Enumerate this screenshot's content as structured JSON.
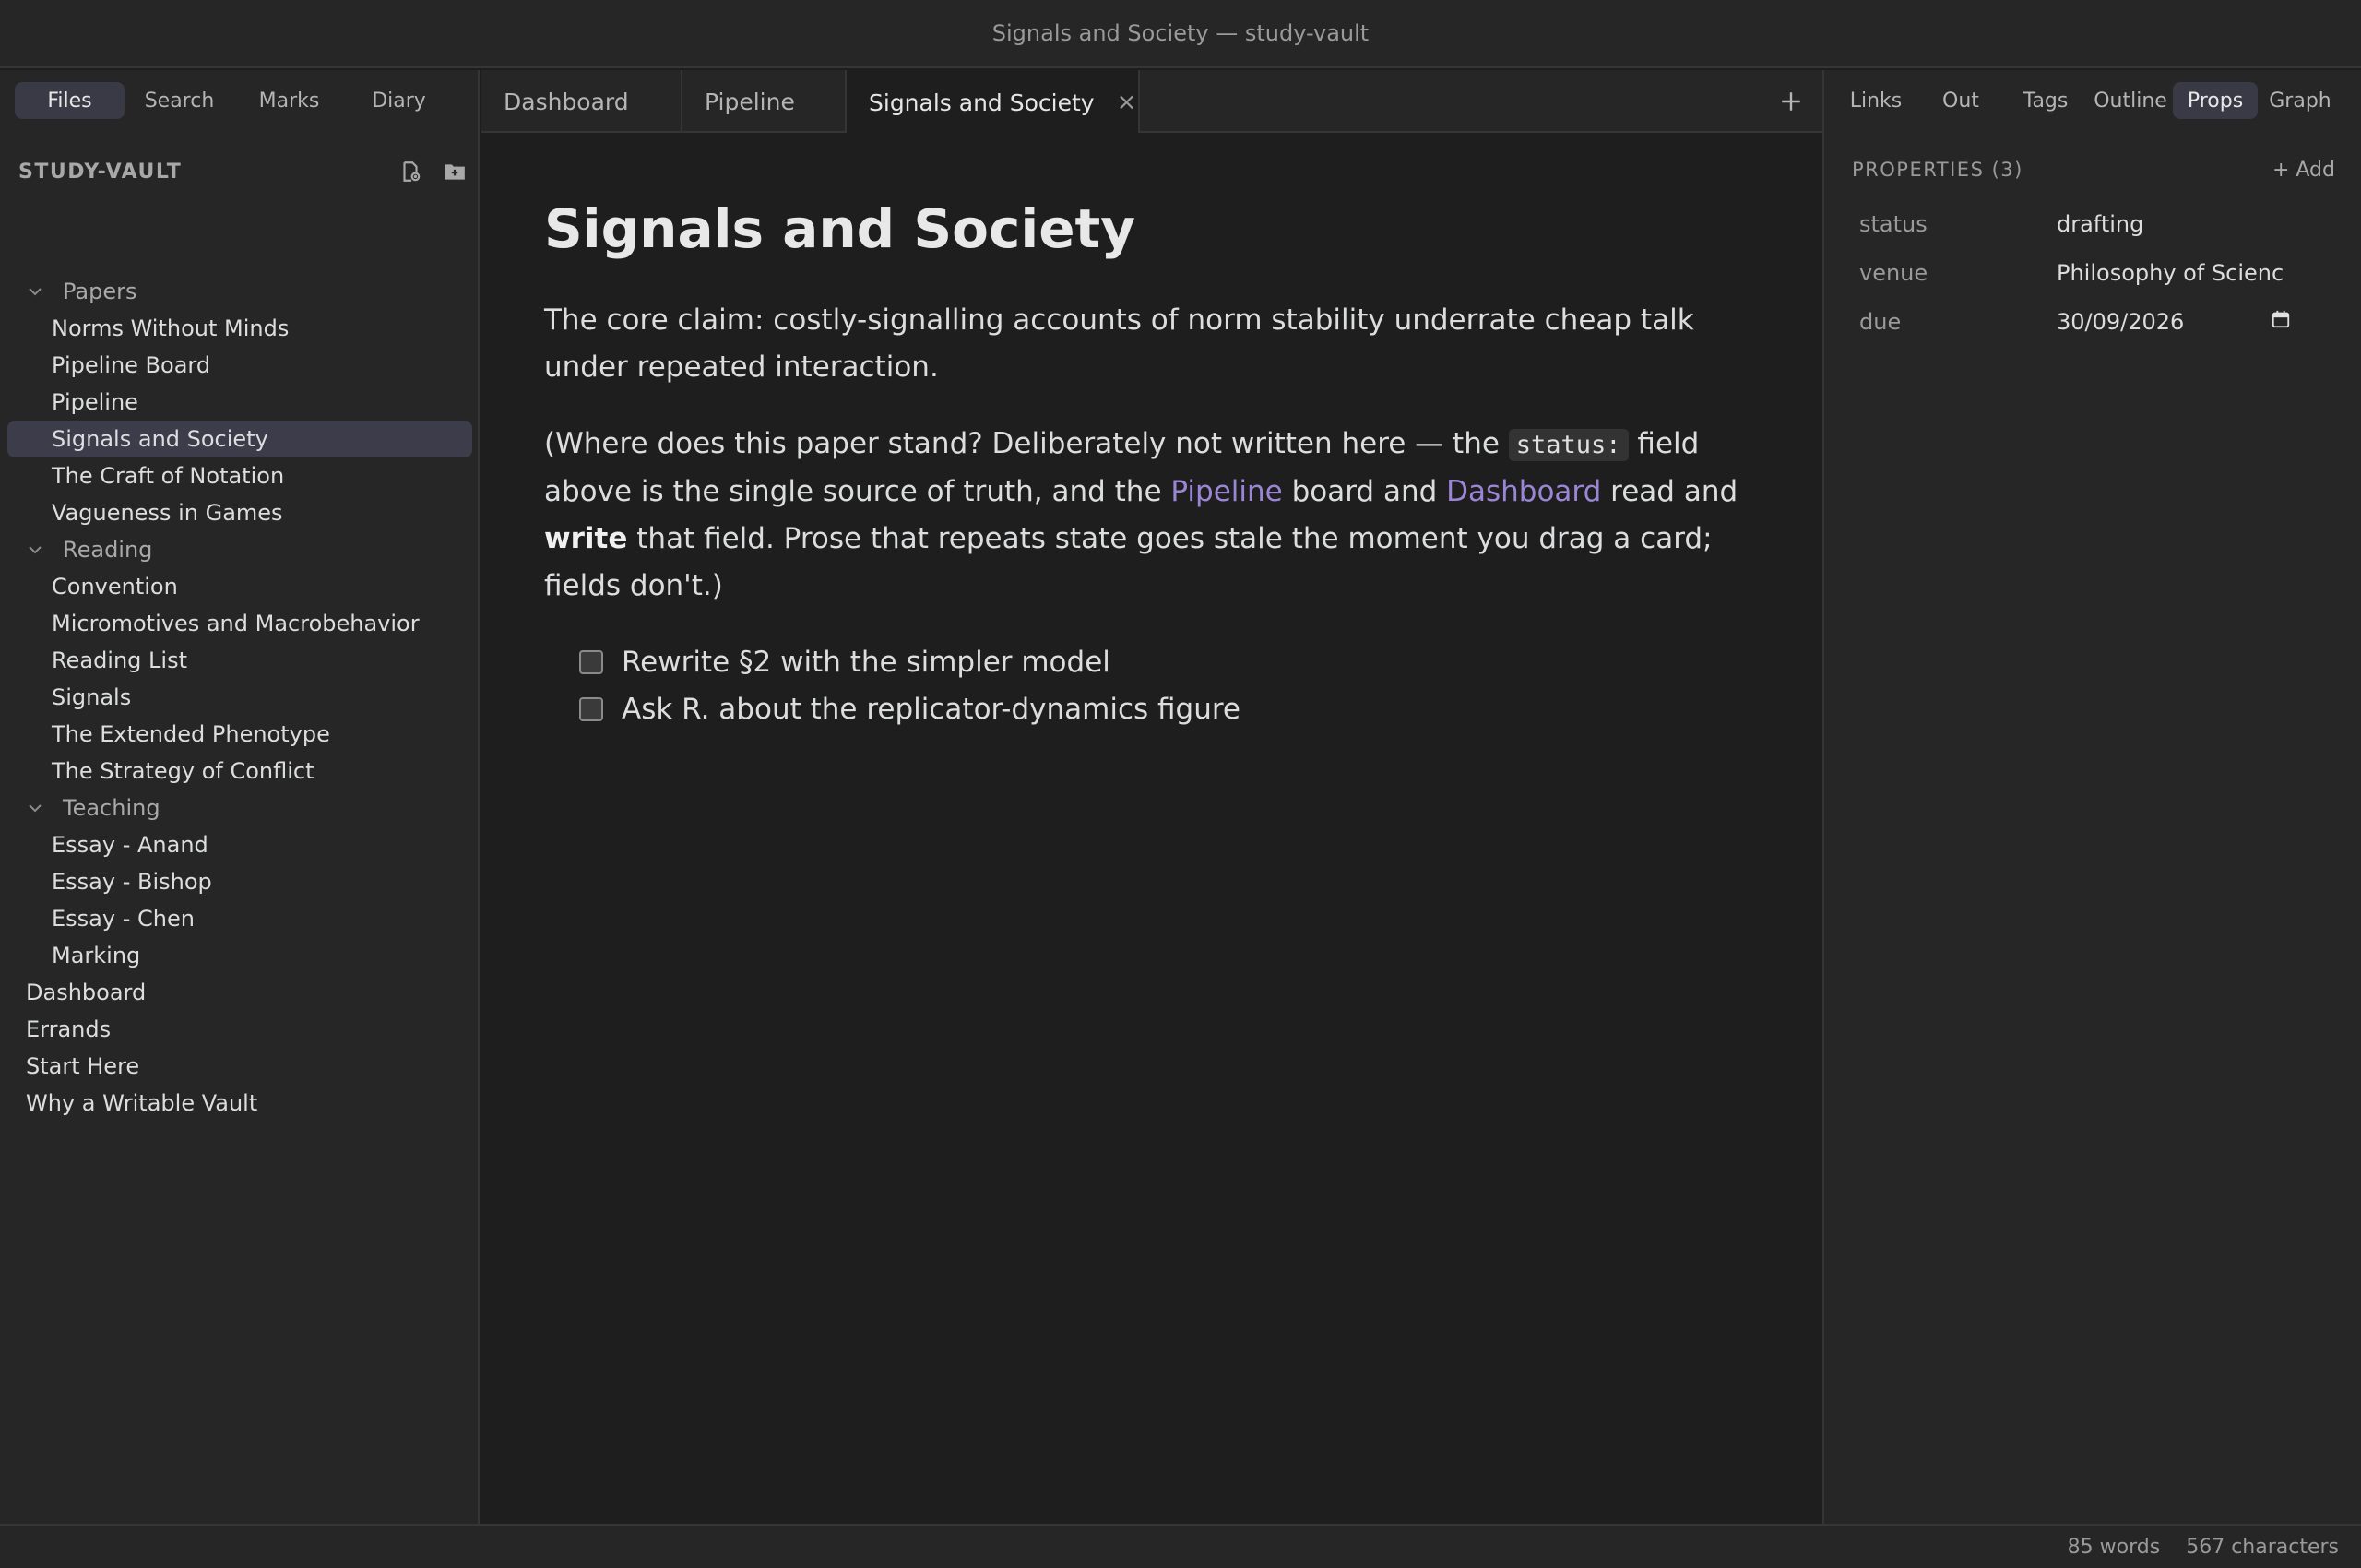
{
  "window": {
    "title": "Signals and Society — study-vault"
  },
  "sidebar": {
    "tabs": [
      "Files",
      "Search",
      "Marks",
      "Diary"
    ],
    "active_tab": "Files",
    "vault_name": "STUDY-VAULT",
    "folders": [
      {
        "name": "Papers",
        "items": [
          "Norms Without Minds",
          "Pipeline Board",
          "Pipeline",
          "Signals and Society",
          "The Craft of Notation",
          "Vagueness in Games"
        ]
      },
      {
        "name": "Reading",
        "items": [
          "Convention",
          "Micromotives and Macrobehavior",
          "Reading List",
          "Signals",
          "The Extended Phenotype",
          "The Strategy of Conflict"
        ]
      },
      {
        "name": "Teaching",
        "items": [
          "Essay - Anand",
          "Essay - Bishop",
          "Essay - Chen",
          "Marking"
        ]
      }
    ],
    "root_files": [
      "Dashboard",
      "Errands",
      "Start Here",
      "Why a Writable Vault"
    ],
    "active_file": "Signals and Society"
  },
  "editor": {
    "tabs": [
      "Dashboard",
      "Pipeline",
      "Signals and Society"
    ],
    "active_tab": "Signals and Society",
    "close_glyph": "×",
    "doc": {
      "title": "Signals and Society",
      "para1": "The core claim: costly-signalling accounts of norm stability underrate cheap talk under repeated interaction.",
      "para2": {
        "t1": "(Where does this paper stand? Deliberately not written here — the ",
        "code": "status:",
        "t2": " field above is the single source of truth, and the ",
        "link1": "Pipeline",
        "t3": " board and ",
        "link2": "Dashboard",
        "t4": " read and ",
        "bold": "write",
        "t5": " that field. Prose that repeats state goes stale the moment you drag a card; fields don't.)"
      },
      "tasks": [
        "Rewrite §2 with the simpler model",
        "Ask R. about the replicator-dynamics figure"
      ]
    }
  },
  "right_panel": {
    "tabs": [
      "Links",
      "Out",
      "Tags",
      "Outline",
      "Props",
      "Graph"
    ],
    "active_tab": "Props",
    "properties_title": "PROPERTIES (3)",
    "add_label": "+ Add",
    "properties": [
      {
        "key": "status",
        "value": "drafting"
      },
      {
        "key": "venue",
        "value": "Philosophy of Scienc"
      },
      {
        "key": "due",
        "value": "30/09/2026"
      }
    ]
  },
  "statusbar": {
    "words": "85 words",
    "characters": "567 characters"
  },
  "colors": {
    "accent": "#9b86d6",
    "active_bg": "#3a3a47",
    "background": "#1e1e1e",
    "panel": "#262626"
  }
}
